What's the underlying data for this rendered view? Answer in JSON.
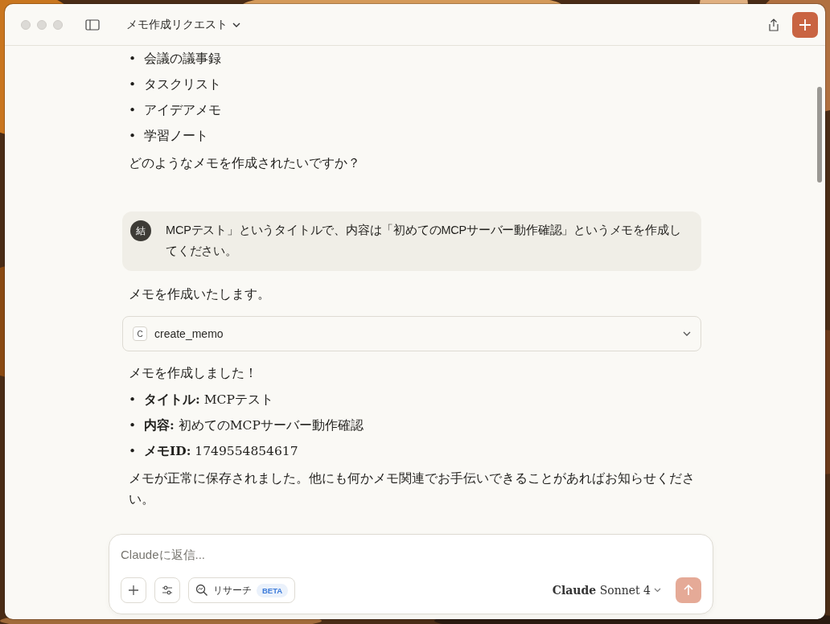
{
  "window": {
    "title": "メモ作成リクエスト"
  },
  "assistant_top": {
    "bullets": [
      {
        "marker": "•",
        "text": "会議の議事録"
      },
      {
        "marker": "•",
        "text": "タスクリスト"
      },
      {
        "marker": "•",
        "text": "アイデアメモ"
      },
      {
        "marker": "•",
        "text": "学習ノート"
      }
    ],
    "question": "どのようなメモを作成されたいですか？"
  },
  "user_message": {
    "avatar": "結",
    "text": "MCPテスト」というタイトルで、内容は「初めてのMCPサーバー動作確認」というメモを作成してください。"
  },
  "assistant_reply": {
    "intro": "メモを作成いたします。",
    "tool": {
      "icon": "C",
      "name": "create_memo",
      "expanded": false
    },
    "result": "メモを作成しました！",
    "details": [
      {
        "marker": "•",
        "text": "**タイトル:** MCPテスト"
      },
      {
        "marker": "•",
        "text": "**内容:** 初めてのMCPサーバー動作確認"
      },
      {
        "marker": "•",
        "text": "**メモID:** 1749554854617"
      }
    ],
    "closing": "メモが正常に保存されました。他にも何かメモ関連でお手伝いできることがあればお知らせください。"
  },
  "composer": {
    "placeholder": "Claudeに返信...",
    "research": {
      "label": "リサーチ",
      "badge": "BETA"
    },
    "model": "**Claude** Sonnet 4"
  }
}
